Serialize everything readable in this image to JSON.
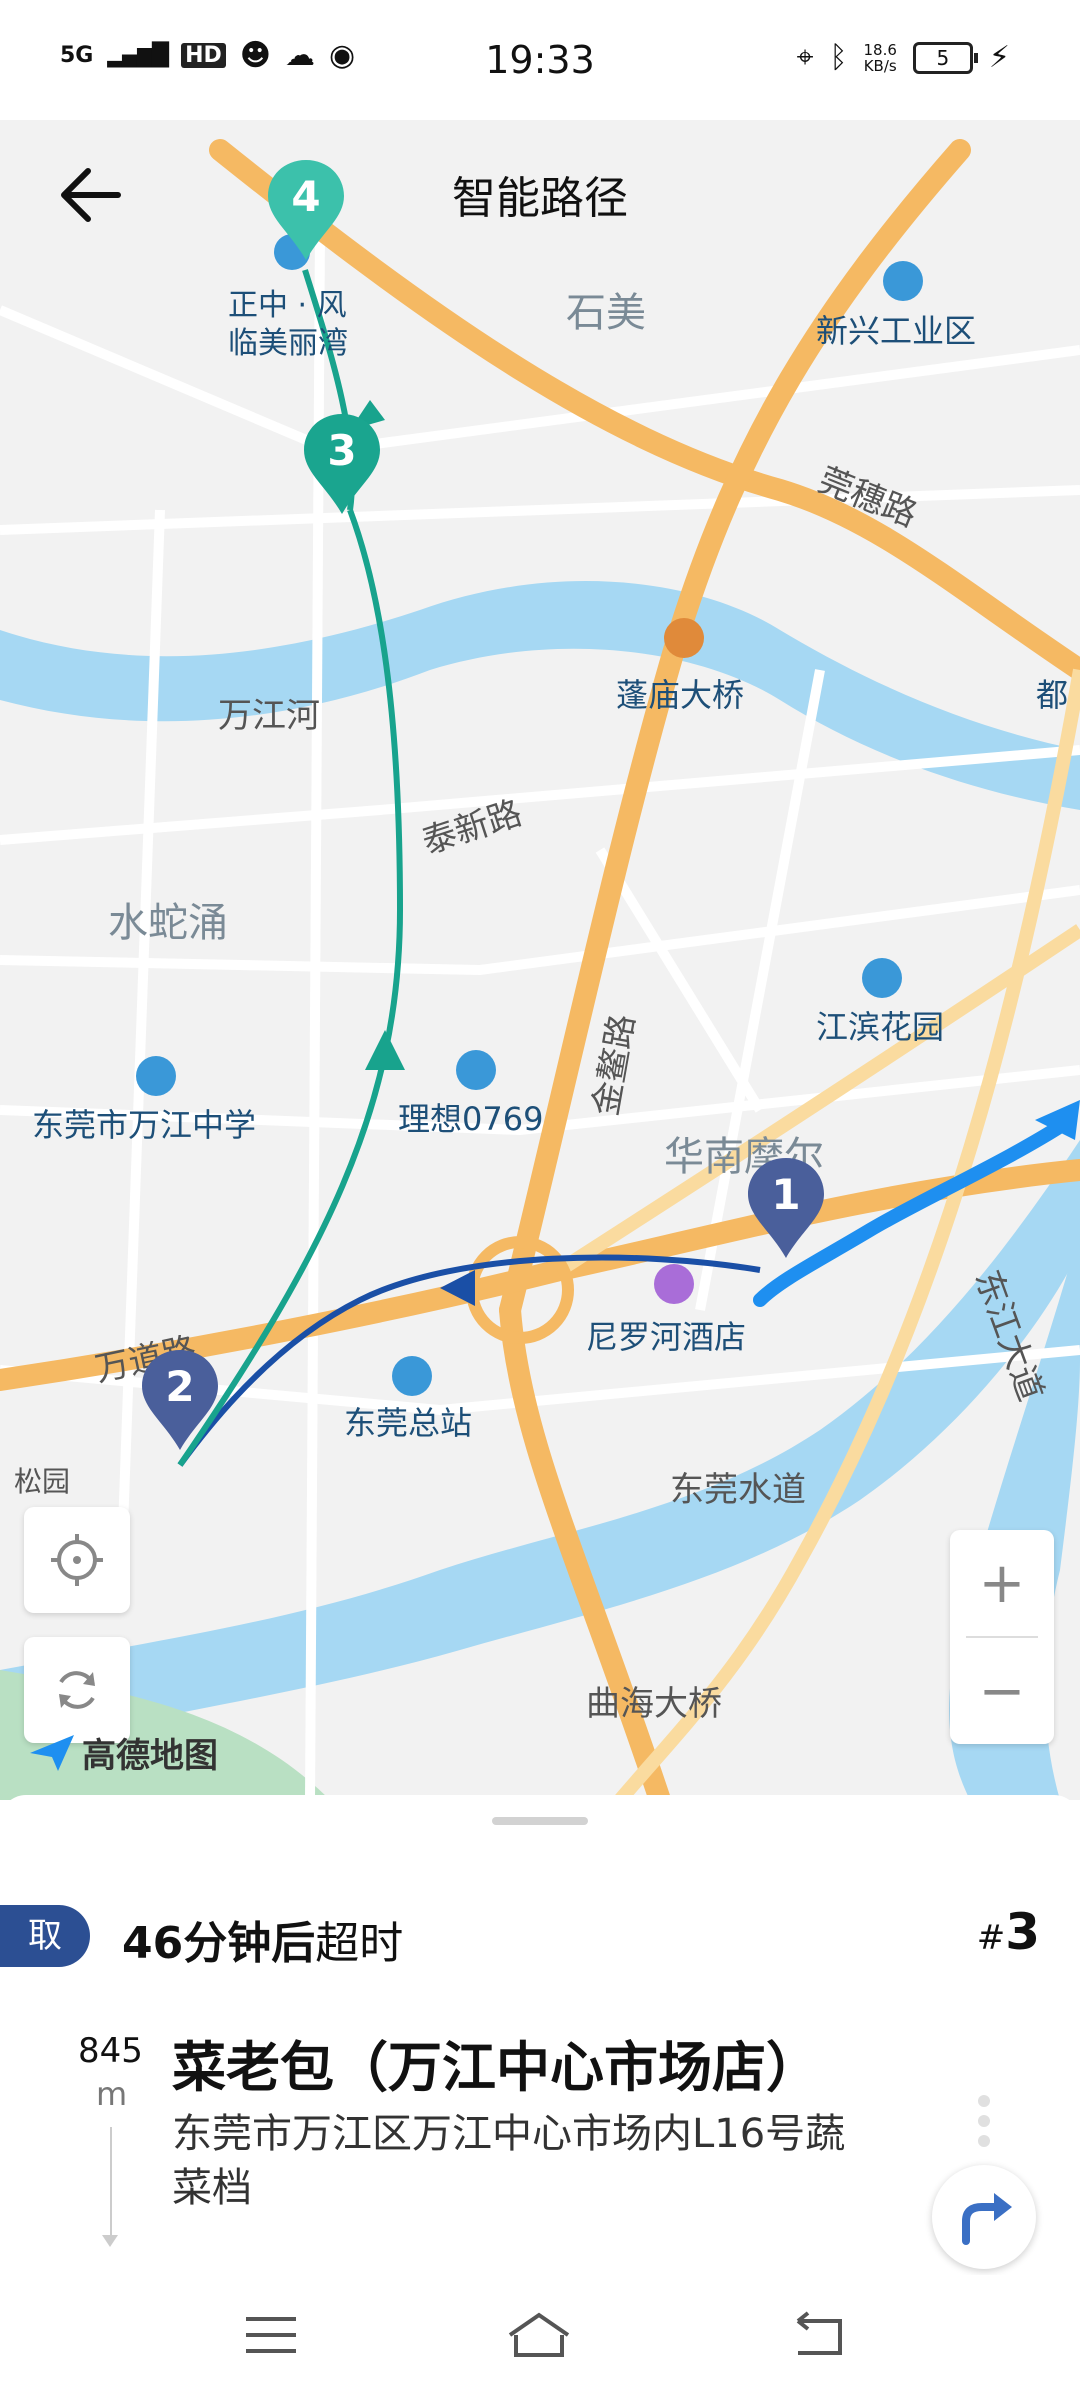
{
  "status_bar": {
    "time": "19:33",
    "network": "5G",
    "hd_badge": "HD",
    "speed_value": "18.6",
    "speed_unit": "KB/s",
    "battery": "5"
  },
  "header": {
    "title": "智能路径"
  },
  "map": {
    "places": {
      "shimei": "石美",
      "xinxing": "新兴工业区",
      "wansui": "莞穗路",
      "dou": "都",
      "penggao": "蓬庙大桥",
      "wanjianghe": "万江河",
      "taixin": "泰新路",
      "jinao": "金鳌路",
      "shuishechong": "水蛇涌",
      "jiangbin": "江滨花园",
      "wanjiang_school": "东莞市万江中学",
      "lixiang": "理想0769",
      "huanan": "华南摩尔",
      "niluohe": "尼罗河酒店",
      "dongjiang": "东江大道",
      "wandao": "万道路",
      "songyuan": "松园",
      "zongzhan": "东莞总站",
      "shuidao": "东莞水道",
      "quhai": "曲海大桥",
      "zhengzhong_1": "正中 · 风",
      "zhengzhong_2": "临美丽湾"
    },
    "markers": [
      "1",
      "2",
      "3",
      "4"
    ],
    "logo_text": "高德地图",
    "zoom_in": "+",
    "zoom_out": "−"
  },
  "order": {
    "tag": "取",
    "timeout_strong": "46分钟后",
    "timeout_rest": "超时",
    "number_prefix": "#",
    "number": "3",
    "distance": "845",
    "distance_unit": "m",
    "shop_name": "菜老包（万江中心市场店）",
    "address": "东莞市万江区万江中心市场内L16号蔬菜档"
  },
  "colors": {
    "route_green": "#18a38d",
    "route_blue": "#1a4fa6",
    "route_light_blue": "#1e8ff0",
    "marker_blue": "#4a5f9b",
    "marker_green": "#1aa58f",
    "road_orange": "#f5b963",
    "water": "#a6d8f3",
    "tag_blue": "#2c4f93"
  }
}
